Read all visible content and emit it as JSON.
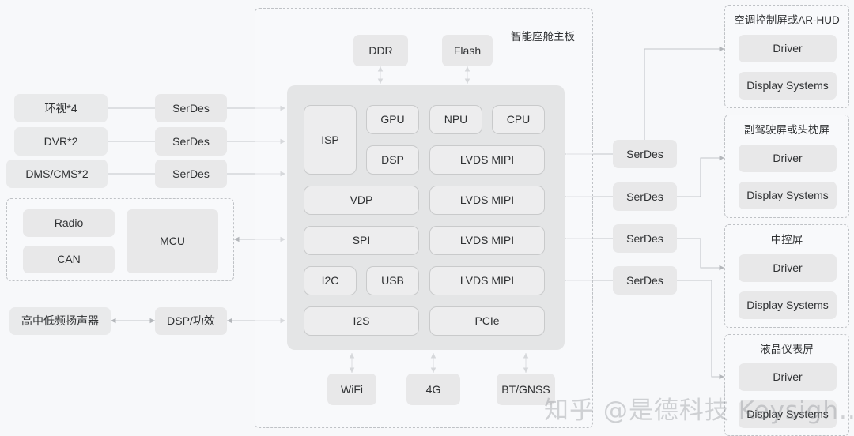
{
  "diagram": {
    "title": "智能座舱主板",
    "watermark": "知乎 @是德科技 Keysigh...",
    "colors": {
      "background": "#f7f8fa",
      "block_fill": "#e8e8e9",
      "board_panel": "#e4e5e6",
      "dashed_border": "#bfc2c6",
      "wire": "#b9bcc0",
      "text": "#2f3133"
    }
  },
  "left_inputs": [
    {
      "label": "环视*4"
    },
    {
      "label": "DVR*2"
    },
    {
      "label": "DMS/CMS*2"
    }
  ],
  "left_serdes": [
    {
      "label": "SerDes"
    },
    {
      "label": "SerDes"
    },
    {
      "label": "SerDes"
    }
  ],
  "mcu_group": {
    "items": [
      {
        "label": "Radio"
      },
      {
        "label": "CAN"
      }
    ],
    "mcu": {
      "label": "MCU"
    }
  },
  "audio": {
    "speaker": {
      "label": "高中低频扬声器"
    },
    "dsp": {
      "label": "DSP/功效"
    }
  },
  "memory": [
    {
      "label": "DDR"
    },
    {
      "label": "Flash"
    }
  ],
  "soc_blocks": {
    "isp": {
      "label": "ISP"
    },
    "row1": [
      {
        "label": "GPU"
      },
      {
        "label": "NPU"
      },
      {
        "label": "CPU"
      }
    ],
    "row2": [
      {
        "label": "DSP"
      },
      {
        "label": "LVDS MIPI"
      }
    ],
    "row3": [
      {
        "label": "VDP"
      },
      {
        "label": "LVDS MIPI"
      }
    ],
    "row4": [
      {
        "label": "SPI"
      },
      {
        "label": "LVDS MIPI"
      }
    ],
    "row5": [
      {
        "label": "I2C"
      },
      {
        "label": "USB"
      },
      {
        "label": "LVDS MIPI"
      }
    ],
    "row6": [
      {
        "label": "I2S"
      },
      {
        "label": "PCIe"
      }
    ]
  },
  "wireless": [
    {
      "label": "WiFi"
    },
    {
      "label": "4G"
    },
    {
      "label": "BT/GNSS"
    }
  ],
  "right_serdes": [
    {
      "label": "SerDes"
    },
    {
      "label": "SerDes"
    },
    {
      "label": "SerDes"
    },
    {
      "label": "SerDes"
    }
  ],
  "displays": [
    {
      "title": "空调控制屏或AR-HUD",
      "driver": "Driver",
      "display_system": "Display Systems"
    },
    {
      "title": "副驾驶屏或头枕屏",
      "driver": "Driver",
      "display_system": "Display Systems"
    },
    {
      "title": "中控屏",
      "driver": "Driver",
      "display_system": "Display Systems"
    },
    {
      "title": "液晶仪表屏",
      "driver": "Driver",
      "display_system": "Display Systems"
    }
  ]
}
